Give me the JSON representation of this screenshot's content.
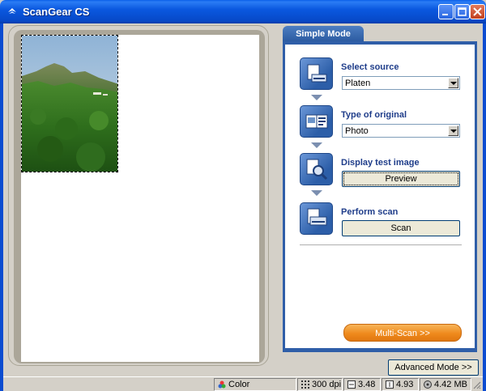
{
  "window": {
    "title": "ScanGear CS",
    "icon": "scanner-app-icon",
    "controls": [
      "minimize",
      "maximize",
      "close"
    ]
  },
  "mode_tab": {
    "label": "Simple Mode"
  },
  "steps": [
    {
      "label": "Select source",
      "icon": "scanner-platen-icon",
      "control": "select",
      "value": "Platen"
    },
    {
      "label": "Type of original",
      "icon": "photo-document-icon",
      "control": "select",
      "value": "Photo"
    },
    {
      "label": "Display test image",
      "icon": "magnifier-preview-icon",
      "control": "button",
      "value": "Preview"
    },
    {
      "label": "Perform scan",
      "icon": "scan-output-icon",
      "control": "button",
      "value": "Scan"
    }
  ],
  "multiscan_button": {
    "label": "Multi-Scan >>"
  },
  "advanced_button": {
    "label": "Advanced Mode >>"
  },
  "status": {
    "color_mode": "Color",
    "resolution": "300 dpi",
    "width": "3.48",
    "height": "4.93",
    "file_size": "4.42 MB"
  },
  "colors": {
    "titlebar": "#0a58df",
    "panel_border": "#2f5ea8",
    "label_blue": "#1f3d8a",
    "multiscan_orange": "#ef8a1d"
  }
}
